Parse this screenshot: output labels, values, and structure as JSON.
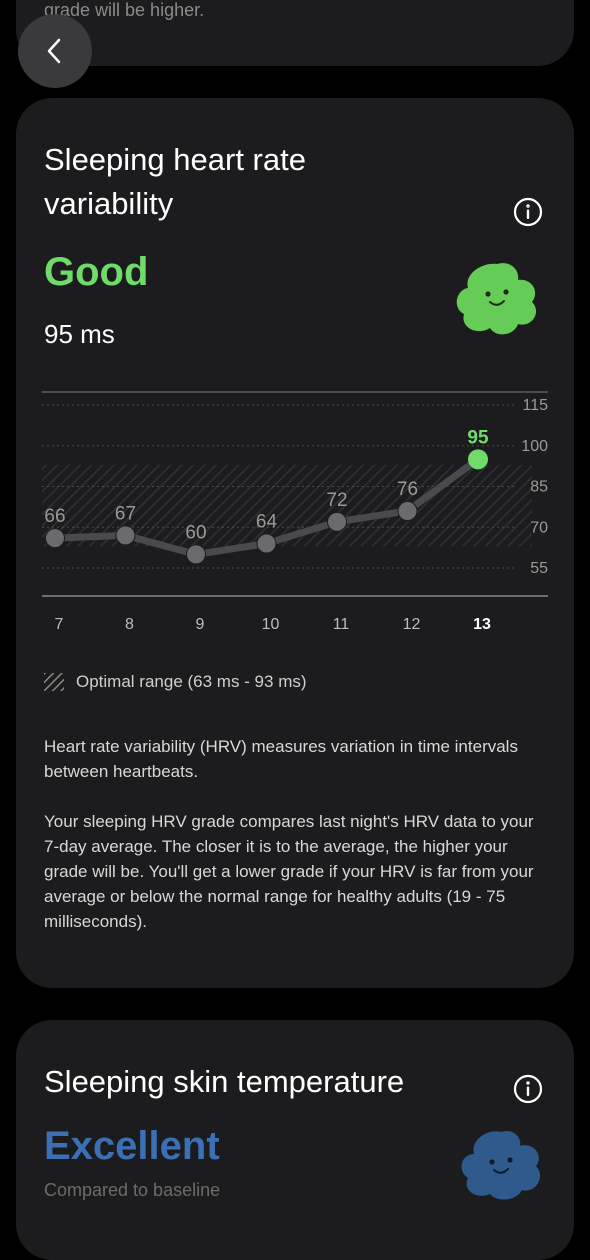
{
  "top_card": {
    "snippet": "grade will be higher."
  },
  "hrv": {
    "title_line1": "Sleeping heart rate",
    "title_line2": "variability",
    "grade": "Good",
    "value": "95 ms",
    "grade_color": "#6fdc6a",
    "legend": "Optimal range (63 ms - 93 ms)",
    "description_p1": "Heart rate variability (HRV) measures variation in time intervals between heartbeats.",
    "description_p2": "Your sleeping HRV grade compares last night's HRV data to your 7-day average. The closer it is to the average, the higher your grade will be. You'll get a lower grade if your HRV is far from your average or below the normal range for healthy adults (19 - 75 milliseconds)."
  },
  "skin": {
    "title": "Sleeping skin temperature",
    "grade": "Excellent",
    "grade_color": "#3b6fb6",
    "subtitle": "Compared to baseline"
  },
  "chart_data": {
    "type": "line",
    "x": [
      "7",
      "8",
      "9",
      "10",
      "11",
      "12",
      "13"
    ],
    "values": [
      66,
      67,
      60,
      64,
      72,
      76,
      95
    ],
    "highlight_index": 6,
    "y_ticks": [
      115,
      100,
      85,
      70,
      55
    ],
    "ylim": [
      55,
      115
    ],
    "optimal_range": [
      63,
      93
    ],
    "title": "",
    "xlabel": "",
    "ylabel": "",
    "line_color": "#4a4a4c",
    "point_color": "#6b6b6d",
    "highlight_color": "#6fdc6a",
    "grid": true
  }
}
